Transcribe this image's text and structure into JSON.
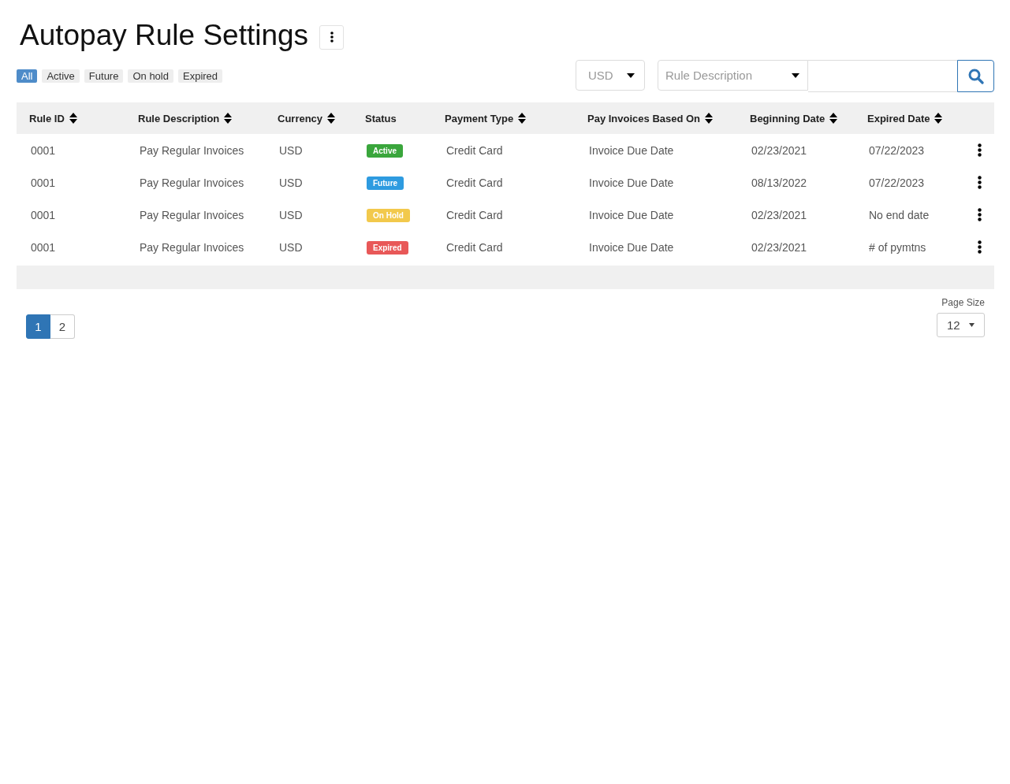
{
  "title": "Autopay Rule Settings",
  "filters": [
    {
      "label": "All",
      "selected": true
    },
    {
      "label": "Active",
      "selected": false
    },
    {
      "label": "Future",
      "selected": false
    },
    {
      "label": "On hold",
      "selected": false
    },
    {
      "label": "Expired",
      "selected": false
    }
  ],
  "currency_select": {
    "value": "USD"
  },
  "search": {
    "field_select": "Rule Description"
  },
  "table": {
    "columns": [
      {
        "label": "Rule ID",
        "sortable": true
      },
      {
        "label": "Rule Description",
        "sortable": true
      },
      {
        "label": "Currency",
        "sortable": true
      },
      {
        "label": "Status",
        "sortable": false
      },
      {
        "label": "Payment Type",
        "sortable": true
      },
      {
        "label": "Pay Invoices Based On",
        "sortable": true
      },
      {
        "label": "Beginning Date",
        "sortable": true
      },
      {
        "label": "Expired Date",
        "sortable": true
      }
    ],
    "rows": [
      {
        "rule_id": "0001",
        "description": "Pay Regular Invoices",
        "currency": "USD",
        "status": {
          "label": "Active",
          "color": "#3aa63c"
        },
        "payment_type": "Credit Card",
        "based_on": "Invoice Due Date",
        "beginning": "02/23/2021",
        "expired": "07/22/2023"
      },
      {
        "rule_id": "0001",
        "description": "Pay Regular Invoices",
        "currency": "USD",
        "status": {
          "label": "Future",
          "color": "#2e9be0"
        },
        "payment_type": "Credit Card",
        "based_on": "Invoice Due Date",
        "beginning": "08/13/2022",
        "expired": "07/22/2023"
      },
      {
        "rule_id": "0001",
        "description": "Pay Regular Invoices",
        "currency": "USD",
        "status": {
          "label": "On Hold",
          "color": "#f2c94c"
        },
        "payment_type": "Credit Card",
        "based_on": "Invoice Due Date",
        "beginning": "02/23/2021",
        "expired": "No end date"
      },
      {
        "rule_id": "0001",
        "description": "Pay Regular Invoices",
        "currency": "USD",
        "status": {
          "label": "Expired",
          "color": "#e85858"
        },
        "payment_type": "Credit Card",
        "based_on": "Invoice Due Date",
        "beginning": "02/23/2021",
        "expired": "# of pymtns"
      }
    ]
  },
  "pagination": [
    {
      "label": "1",
      "selected": true
    },
    {
      "label": "2",
      "selected": false
    }
  ],
  "page_size": {
    "label": "Page Size",
    "value": "12"
  }
}
